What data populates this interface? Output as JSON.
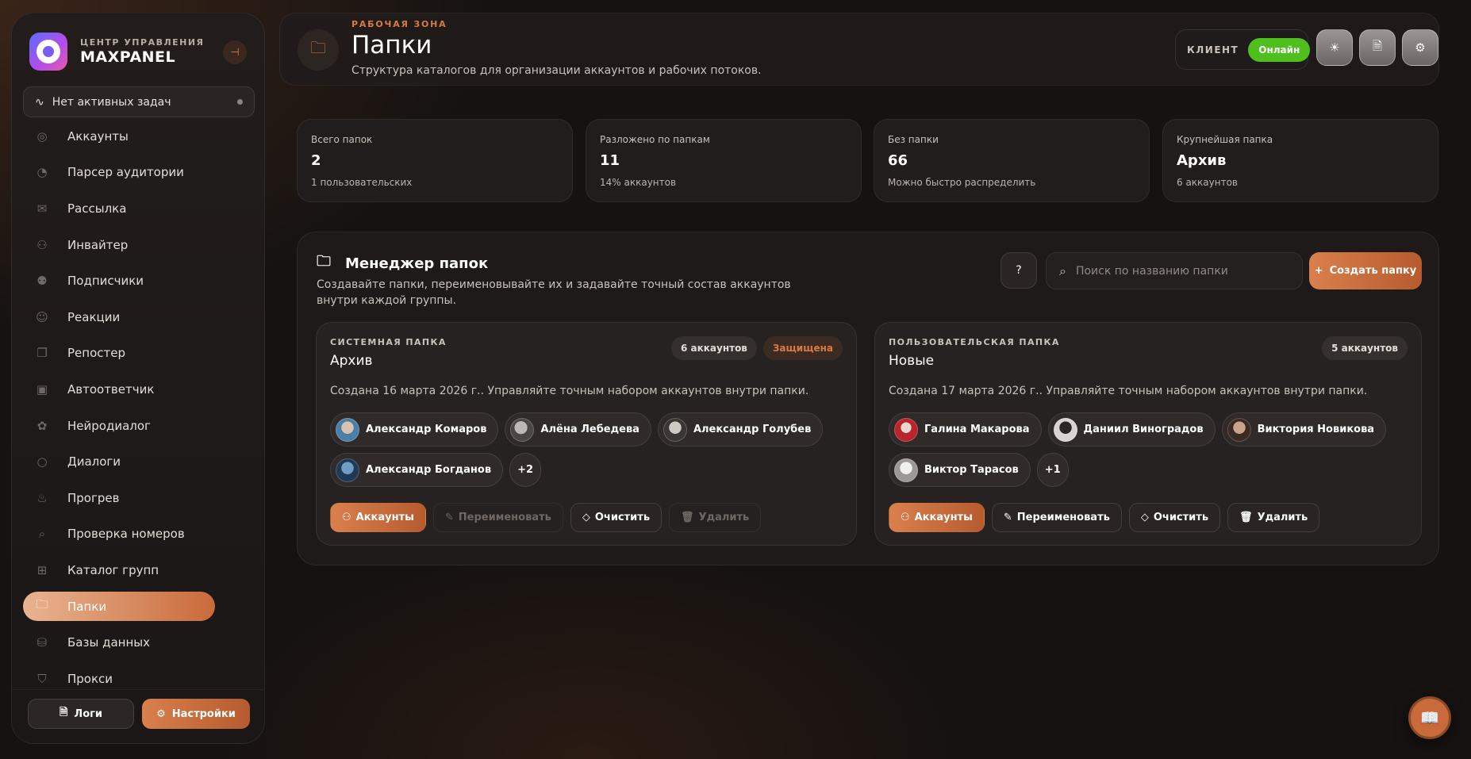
{
  "brand": {
    "subtitle": "ЦЕНТР УПРАВЛЕНИЯ",
    "title": "MAXPANEL"
  },
  "task_status": "Нет активных задач",
  "nav": [
    {
      "label": "Аккаунты",
      "icon": "user-circle-icon"
    },
    {
      "label": "Парсер аудитории",
      "icon": "radar-icon"
    },
    {
      "label": "Рассылка",
      "icon": "mail-icon"
    },
    {
      "label": "Инвайтер",
      "icon": "user-plus-icon"
    },
    {
      "label": "Подписчики",
      "icon": "users-icon"
    },
    {
      "label": "Реакции",
      "icon": "smile-icon"
    },
    {
      "label": "Репостер",
      "icon": "copy-icon"
    },
    {
      "label": "Автоответчик",
      "icon": "bot-icon"
    },
    {
      "label": "Нейродиалог",
      "icon": "brain-icon"
    },
    {
      "label": "Диалоги",
      "icon": "chat-icon"
    },
    {
      "label": "Прогрев",
      "icon": "flame-icon"
    },
    {
      "label": "Проверка номеров",
      "icon": "phone-search-icon"
    },
    {
      "label": "Каталог групп",
      "icon": "grid-icon"
    },
    {
      "label": "Папки",
      "icon": "folder-icon",
      "active": true
    },
    {
      "label": "Базы данных",
      "icon": "database-icon"
    },
    {
      "label": "Прокси",
      "icon": "shield-icon"
    }
  ],
  "sidebar_buttons": {
    "logs": "Логи",
    "settings": "Настройки"
  },
  "header": {
    "eyebrow": "РАБОЧАЯ ЗОНА",
    "title": "Папки",
    "subtitle": "Структура каталогов для организации аккаунтов и рабочих потоков.",
    "client_label": "КЛИЕНТ",
    "client_status": "Онлайн",
    "status_color": "#4fbf1e"
  },
  "stats": [
    {
      "label": "Всего папок",
      "value": "2",
      "sub": "1 пользовательских"
    },
    {
      "label": "Разложено по папкам",
      "value": "11",
      "sub": "14% аккаунтов"
    },
    {
      "label": "Без папки",
      "value": "66",
      "sub": "Можно быстро распределить"
    },
    {
      "label": "Крупнейшая папка",
      "value": "Архив",
      "sub": "6 аккаунтов"
    }
  ],
  "manager": {
    "title": "Менеджер папок",
    "description": "Создавайте папки, переименовывайте их и задавайте точный состав аккаунтов внутри каждой группы.",
    "search_placeholder": "Поиск по названию папки",
    "create_label": "Создать папку"
  },
  "folders": [
    {
      "type": "СИСТЕМНАЯ ПАПКА",
      "name": "Архив",
      "count": "6 аккаунтов",
      "protected": "Защищена",
      "description": "Создана 16 марта 2026 г.. Управляйте точным набором аккаунтов внутри папки.",
      "members": [
        "Александр Комаров",
        "Алёна Лебедева",
        "Александр Голубев",
        "Александр Богданов"
      ],
      "more": "+2",
      "actions": {
        "accounts": "Аккаунты",
        "rename": "Переименовать",
        "clear": "Очистить",
        "delete": "Удалить"
      }
    },
    {
      "type": "ПОЛЬЗОВАТЕЛЬСКАЯ ПАПКА",
      "name": "Новые",
      "count": "5 аккаунтов",
      "description": "Создана 17 марта 2026 г.. Управляйте точным набором аккаунтов внутри папки.",
      "members": [
        "Галина Макарова",
        "Даниил Виноградов",
        "Виктория Новикова",
        "Виктор Тарасов"
      ],
      "more": "+1",
      "actions": {
        "accounts": "Аккаунты",
        "rename": "Переименовать",
        "clear": "Очистить",
        "delete": "Удалить"
      }
    }
  ],
  "colors": {
    "accent": "#d97a45",
    "accent_dark": "#b65b2e",
    "background": "#151211"
  }
}
